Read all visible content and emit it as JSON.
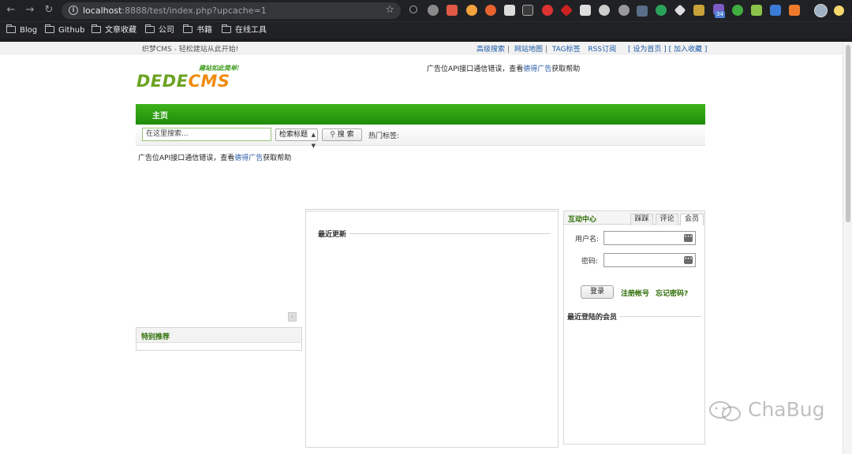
{
  "browser": {
    "url_host": "localhost",
    "url_rest": ":8888/test/index.php?upcache=1",
    "extension_badge": "34",
    "bookmarks": [
      "Blog",
      "Github",
      "文章收藏",
      "公司",
      "书籍",
      "在线工具"
    ]
  },
  "site": {
    "slogan": "织梦CMS - 轻松建站从此开始!",
    "top_links": [
      "高级搜索",
      "网站地图",
      "TAG标签",
      "RSS订阅"
    ],
    "set_home": "[ 设为首页 ]",
    "add_fav": "[ 加入收藏 ]",
    "logo_tagline": "建站如此简单!",
    "logo_text_green": "DEDE",
    "logo_text_orange": "CMS",
    "ad_prefix": "广告位API接口通信错误，查看",
    "ad_link": "德得广告",
    "ad_suffix": "获取帮助",
    "nav_home": "主页",
    "search_placeholder": "在这里搜索...",
    "search_select": "检索标题",
    "search_button": "搜 索",
    "hot_tags": "热门标签:",
    "special": "特别推荐",
    "latest": "最近更新",
    "interact_title": "互动中心",
    "tabs": [
      "踩踩",
      "评论",
      "会员"
    ],
    "username_label": "用户名:",
    "password_label": "密码:",
    "login_button": "登录",
    "register_link": "注册帐号",
    "forgot_link": "忘记密码?",
    "recent_members": "最近登陆的会员",
    "watermark": "ChaBug"
  },
  "colors": {
    "nav_green": "#2a9e12",
    "link_blue": "#1b5aa6",
    "logo_orange": "#ef8b10",
    "logo_green": "#6ca322"
  }
}
